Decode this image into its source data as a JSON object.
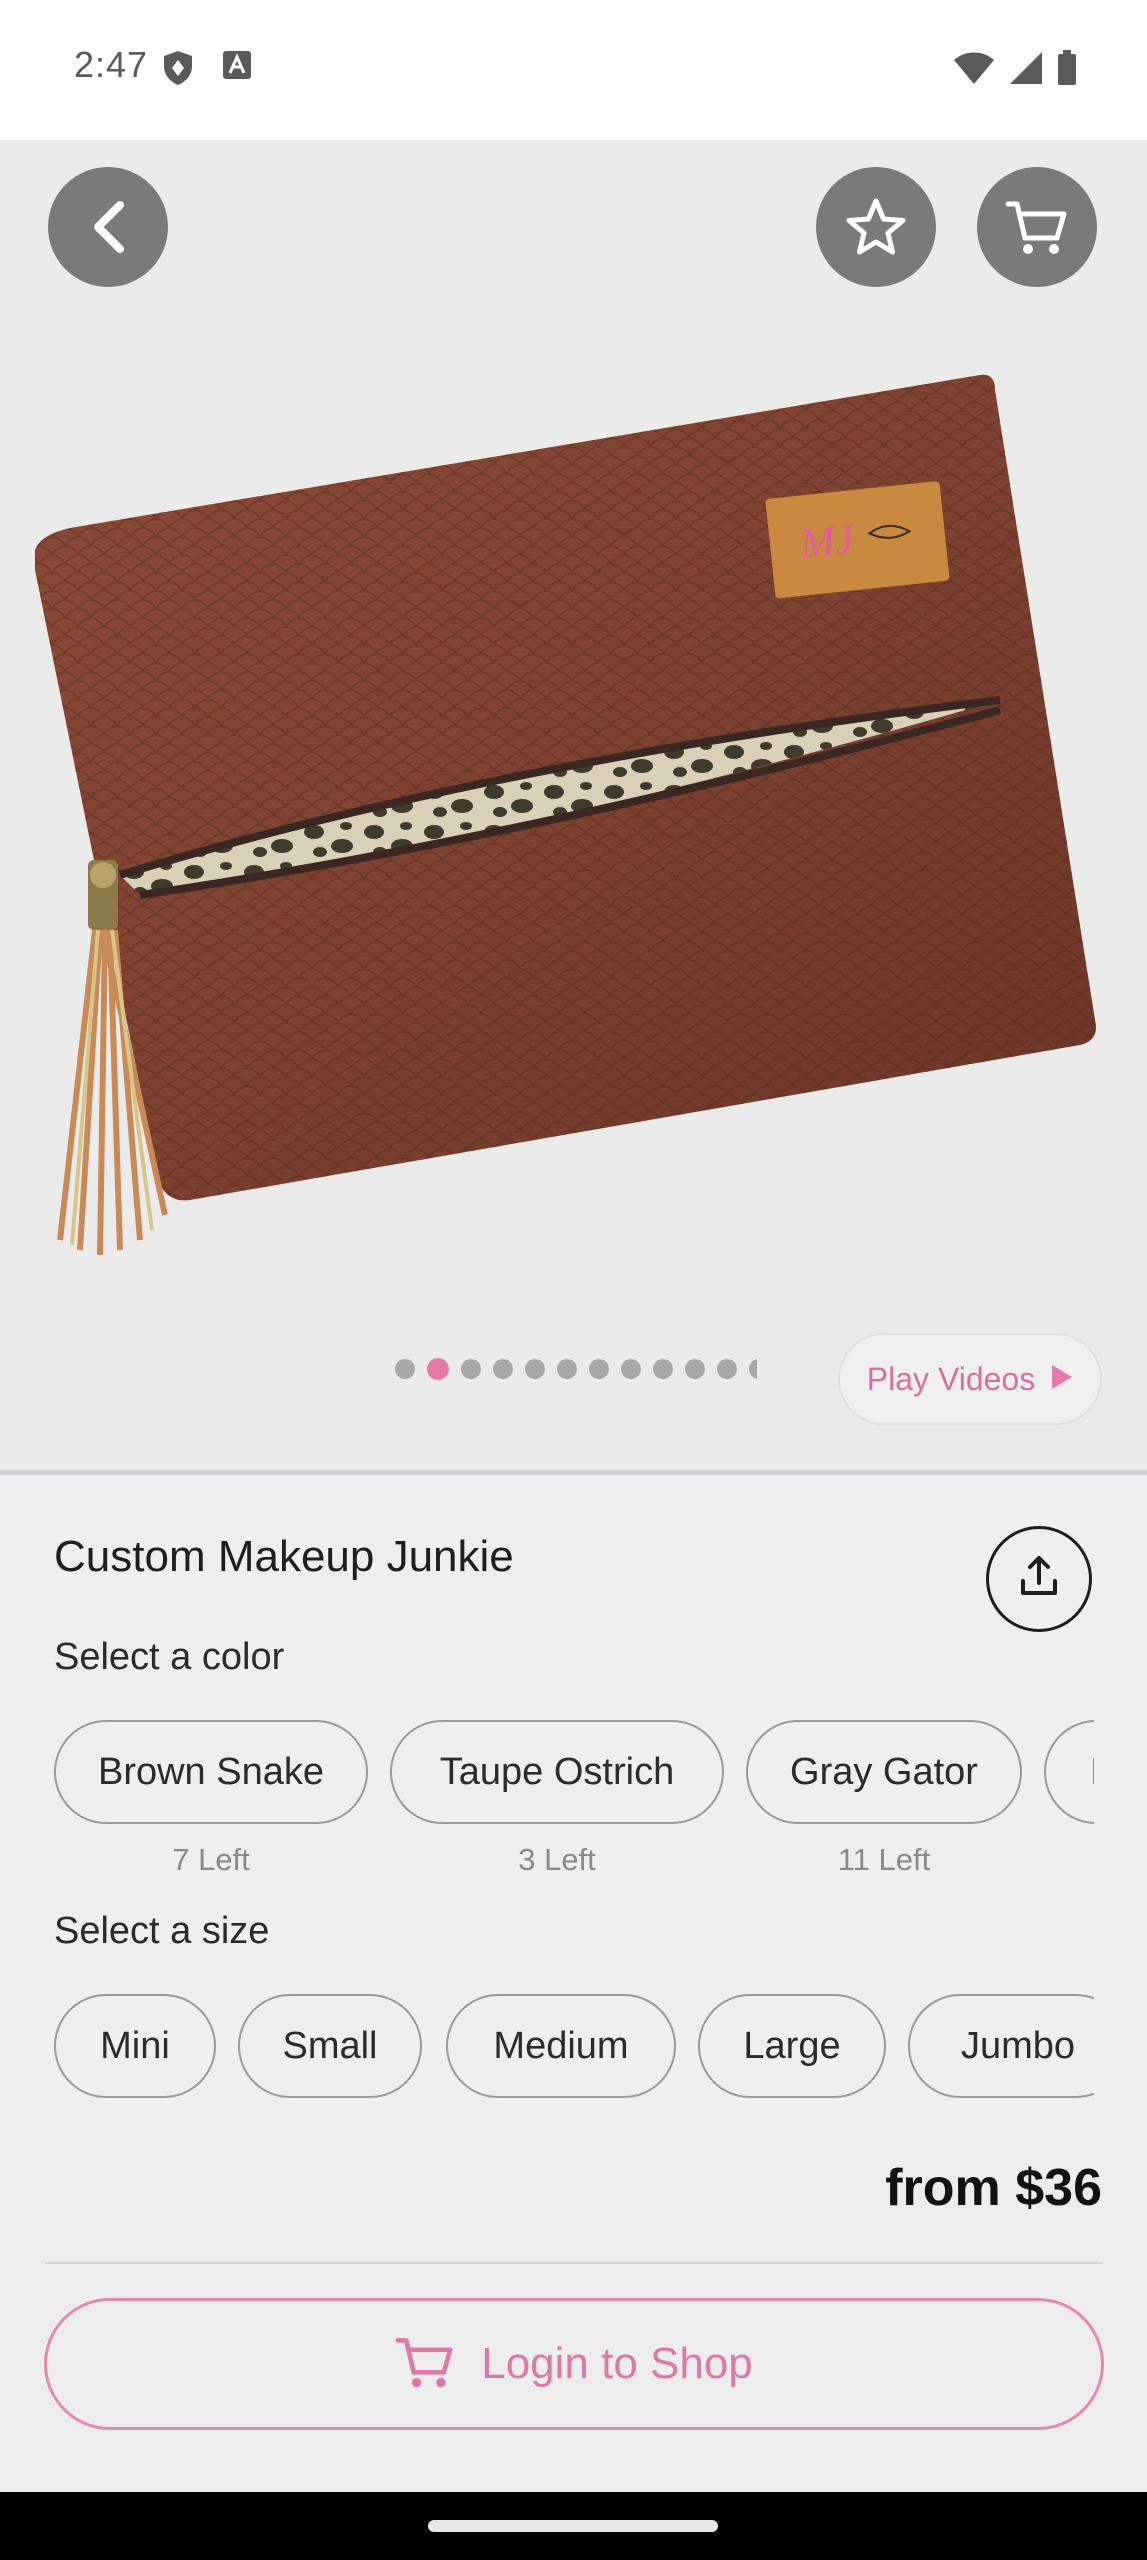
{
  "status_bar": {
    "time": "2:47",
    "icons_left": [
      "shield-icon",
      "a-box-icon"
    ],
    "icons_right": [
      "wifi-icon",
      "cell-signal-icon",
      "battery-icon"
    ]
  },
  "hero": {
    "back_icon": "chevron-left-icon",
    "favorite_icon": "star-icon",
    "cart_icon": "cart-icon",
    "carousel": {
      "total_visible_dots": 11,
      "active_index": 1
    },
    "play_videos_label": "Play Videos",
    "image_logo_text": "MJ"
  },
  "product": {
    "title": "Custom Makeup Junkie",
    "share_icon": "share-icon",
    "color_label": "Select a color",
    "colors": [
      {
        "name": "Brown Snake",
        "stock": "7 Left"
      },
      {
        "name": "Taupe Ostrich",
        "stock": "3 Left"
      },
      {
        "name": "Gray Gator",
        "stock": "11 Left"
      },
      {
        "name": "I",
        "stock": ""
      }
    ],
    "size_label": "Select a size",
    "sizes": [
      "Mini",
      "Small",
      "Medium",
      "Large",
      "Jumbo"
    ],
    "price": "from $36",
    "login_label": "Login to Shop"
  },
  "colors": {
    "accent_pink": "#db7aa6",
    "button_gray": "#7a7a7a"
  }
}
